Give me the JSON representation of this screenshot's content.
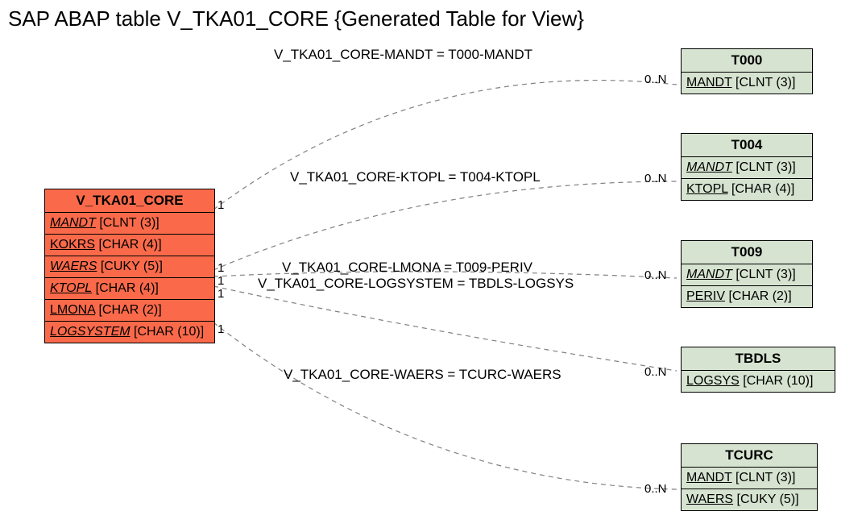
{
  "title": "SAP ABAP table V_TKA01_CORE {Generated Table for View}",
  "main": {
    "name": "V_TKA01_CORE",
    "fields": [
      {
        "name": "MANDT",
        "type": "[CLNT (3)]",
        "italic": true
      },
      {
        "name": "KOKRS",
        "type": "[CHAR (4)]",
        "italic": false
      },
      {
        "name": "WAERS",
        "type": "[CUKY (5)]",
        "italic": true
      },
      {
        "name": "KTOPL",
        "type": "[CHAR (4)]",
        "italic": true
      },
      {
        "name": "LMONA",
        "type": "[CHAR (2)]",
        "italic": false
      },
      {
        "name": "LOGSYSTEM",
        "type": "[CHAR (10)]",
        "italic": true
      }
    ]
  },
  "targets": [
    {
      "name": "T000",
      "fields": [
        {
          "name": "MANDT",
          "type": "[CLNT (3)]",
          "italic": false
        }
      ]
    },
    {
      "name": "T004",
      "fields": [
        {
          "name": "MANDT",
          "type": "[CLNT (3)]",
          "italic": true
        },
        {
          "name": "KTOPL",
          "type": "[CHAR (4)]",
          "italic": false
        }
      ]
    },
    {
      "name": "T009",
      "fields": [
        {
          "name": "MANDT",
          "type": "[CLNT (3)]",
          "italic": true
        },
        {
          "name": "PERIV",
          "type": "[CHAR (2)]",
          "italic": false
        }
      ]
    },
    {
      "name": "TBDLS",
      "fields": [
        {
          "name": "LOGSYS",
          "type": "[CHAR (10)]",
          "italic": false
        }
      ]
    },
    {
      "name": "TCURC",
      "fields": [
        {
          "name": "MANDT",
          "type": "[CLNT (3)]",
          "italic": false
        },
        {
          "name": "WAERS",
          "type": "[CUKY (5)]",
          "italic": false
        }
      ]
    }
  ],
  "relations": [
    {
      "label": "V_TKA01_CORE-MANDT = T000-MANDT"
    },
    {
      "label": "V_TKA01_CORE-KTOPL = T004-KTOPL"
    },
    {
      "label": "V_TKA01_CORE-LMONA = T009-PERIV"
    },
    {
      "label": "V_TKA01_CORE-LOGSYSTEM = TBDLS-LOGSYS"
    },
    {
      "label": "V_TKA01_CORE-WAERS = TCURC-WAERS"
    }
  ],
  "cardinality": {
    "left": "1",
    "right": "0..N"
  }
}
